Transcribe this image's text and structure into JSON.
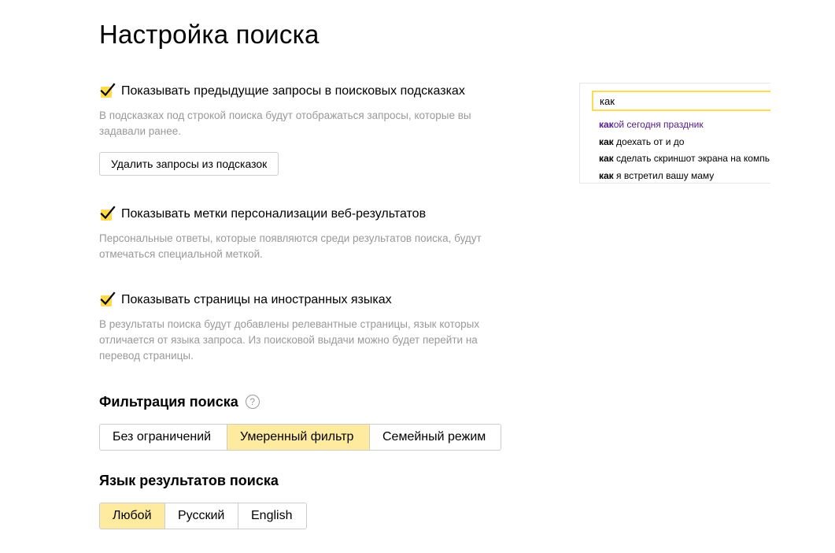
{
  "page": {
    "title": "Настройка поиска"
  },
  "options": [
    {
      "label": "Показывать предыдущие запросы в поисковых подсказках",
      "checked": true,
      "description": "В подсказках под строкой поиска будут отображаться запросы, которые вы задавали ранее.",
      "button_label": "Удалить запросы из подсказок"
    },
    {
      "label": "Показывать метки персонализации веб-результатов",
      "checked": true,
      "description": "Персональные ответы, которые появляются среди результатов поиска, будут отмечаться специальной меткой."
    },
    {
      "label": "Показывать страницы на иностранных языках",
      "checked": true,
      "description": "В результаты поиска будут добавлены релевантные страницы, язык которых отличается от языка запроса. Из поисковой выдачи можно будет перейти на перевод страницы."
    }
  ],
  "filter": {
    "title": "Фильтрация поиска",
    "help_icon": "?",
    "options": [
      "Без ограничений",
      "Умеренный фильтр",
      "Семейный режим"
    ],
    "selected": "Умеренный фильтр"
  },
  "language": {
    "title": "Язык результатов поиска",
    "options": [
      "Любой",
      "Русский",
      "English"
    ],
    "selected": "Любой"
  },
  "preview": {
    "query": "как",
    "suggestions": [
      {
        "prefix": "как",
        "rest": "ой сегодня праздник",
        "visited": true
      },
      {
        "prefix": "как",
        "rest": " доехать от и до",
        "visited": false
      },
      {
        "prefix": "как",
        "rest": " сделать скриншот экрана на компь",
        "visited": false
      },
      {
        "prefix": "как",
        "rest": " я встретил вашу маму",
        "visited": false
      }
    ]
  },
  "colors": {
    "accent_yellow": "#ffdb4d",
    "selected_segment": "#ffeba0",
    "muted_text": "#999999",
    "border": "#cccccc",
    "visited_link": "#551a8b"
  },
  "icons": {
    "checkbox": "checkmark-icon",
    "help": "question-circle-icon"
  }
}
